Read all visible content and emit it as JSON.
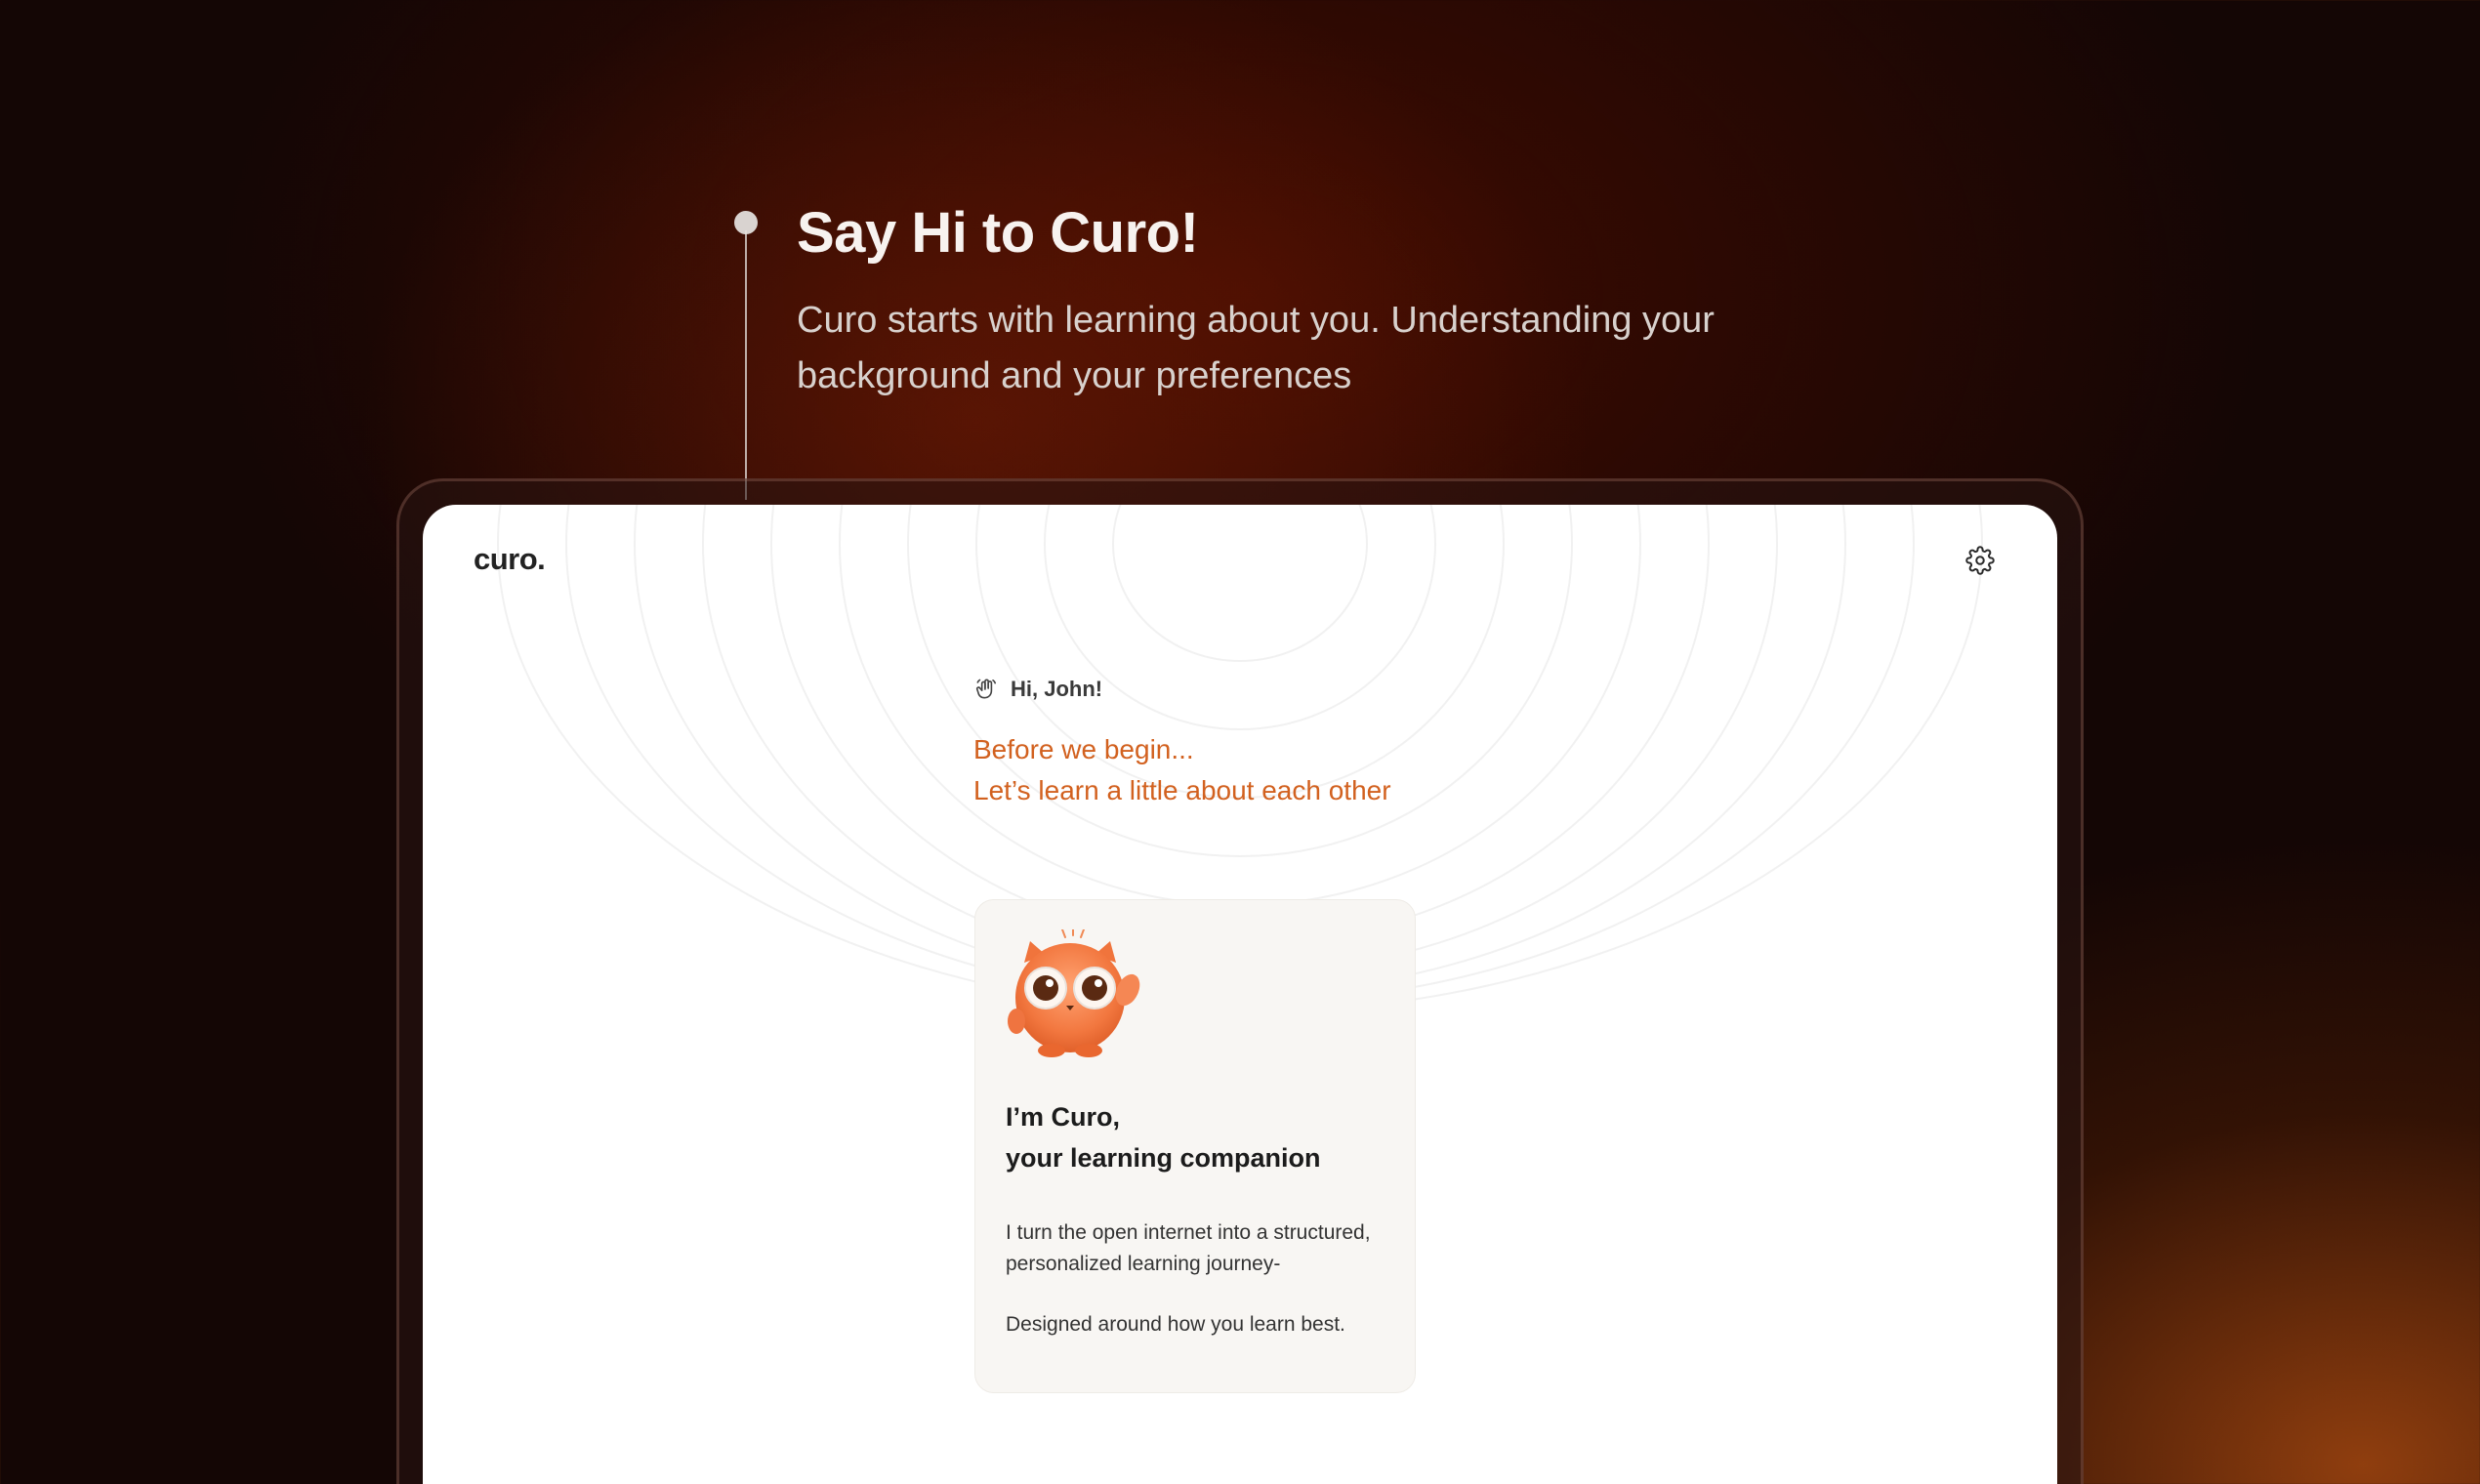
{
  "intro": {
    "title": "Say Hi to Curo!",
    "description": "Curo starts with learning about you. Understanding your background and your preferences"
  },
  "app": {
    "logo": "curo.",
    "settings_icon": "gear-icon",
    "greeting_icon": "wave-hand-icon",
    "greeting": "Hi, John!",
    "intro_line_1": "Before we begin...",
    "intro_line_2": "Let’s learn a little about each other",
    "accent_color": "#d2611f"
  },
  "card": {
    "mascot_icon": "curo-mascot",
    "title_line_1": "I’m Curo,",
    "title_line_2": "your learning companion",
    "body_1": "I turn the open internet into a structured, personalized learning journey-",
    "body_2": "Designed around how you learn best."
  }
}
